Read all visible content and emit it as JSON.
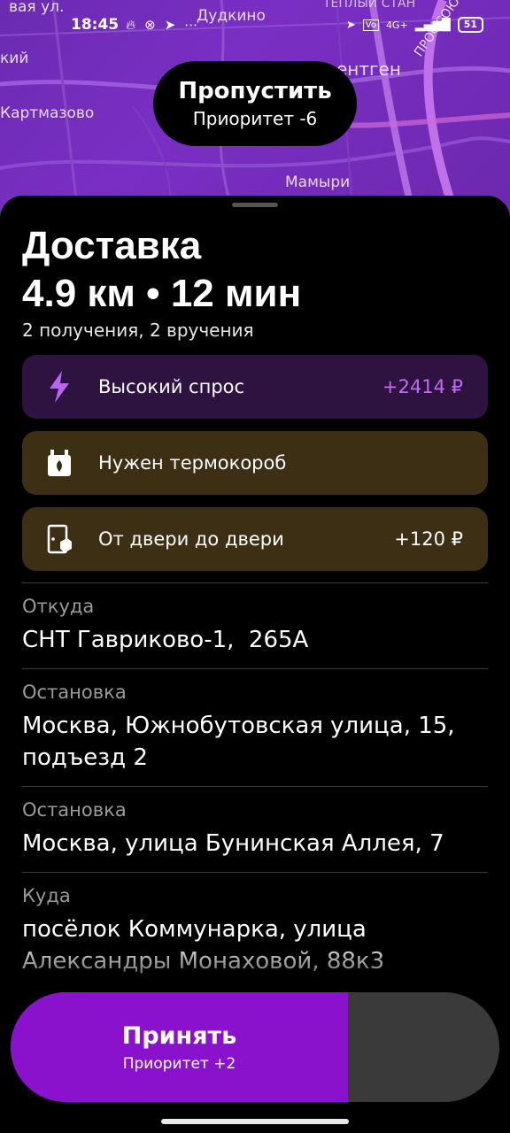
{
  "status_bar": {
    "time": "18:45",
    "network": "4G+",
    "battery": "51"
  },
  "map": {
    "labels": [
      "Дудкино",
      "ТЁПЛЫЙ СТАН",
      "кий",
      "ентген",
      "Картмазово",
      "ПРОФСОЮЗНАЯ",
      "Мамыри",
      "вая ул."
    ]
  },
  "skip": {
    "title": "Пропустить",
    "subtitle": "Приоритет -6"
  },
  "order": {
    "title": "Доставка",
    "summary": "4.9 км • 12 мин",
    "counts": "2 получения, 2 вручения"
  },
  "cards": {
    "demand": {
      "label": "Высокий спрос",
      "value": "+2414 ₽",
      "icon": "lightning-icon",
      "color": "#c06bf5"
    },
    "thermo": {
      "label": "Нужен термокороб",
      "icon": "thermobox-icon"
    },
    "door": {
      "label": "От двери до двери",
      "value": "+120 ₽",
      "icon": "door-icon"
    }
  },
  "stops": [
    {
      "label": "Откуда",
      "address": "СНТ Гавриково-1,  265А"
    },
    {
      "label": "Остановка",
      "address": "Москва, Южнобутовская улица, 15, подъезд 2"
    },
    {
      "label": "Остановка",
      "address": "Москва, улица Бунинская Аллея, 7"
    },
    {
      "label": "Куда",
      "address": "посёлок Коммунарка, улица Александры Монаховой, 88к3"
    }
  ],
  "accept": {
    "title": "Принять",
    "subtitle": "Приоритет +2",
    "progress": 0.69
  },
  "colors": {
    "accent": "#8a12cc",
    "map": "#7a2fc4",
    "card_warm": "#3d2f14",
    "card_demand": "#2e1340"
  }
}
